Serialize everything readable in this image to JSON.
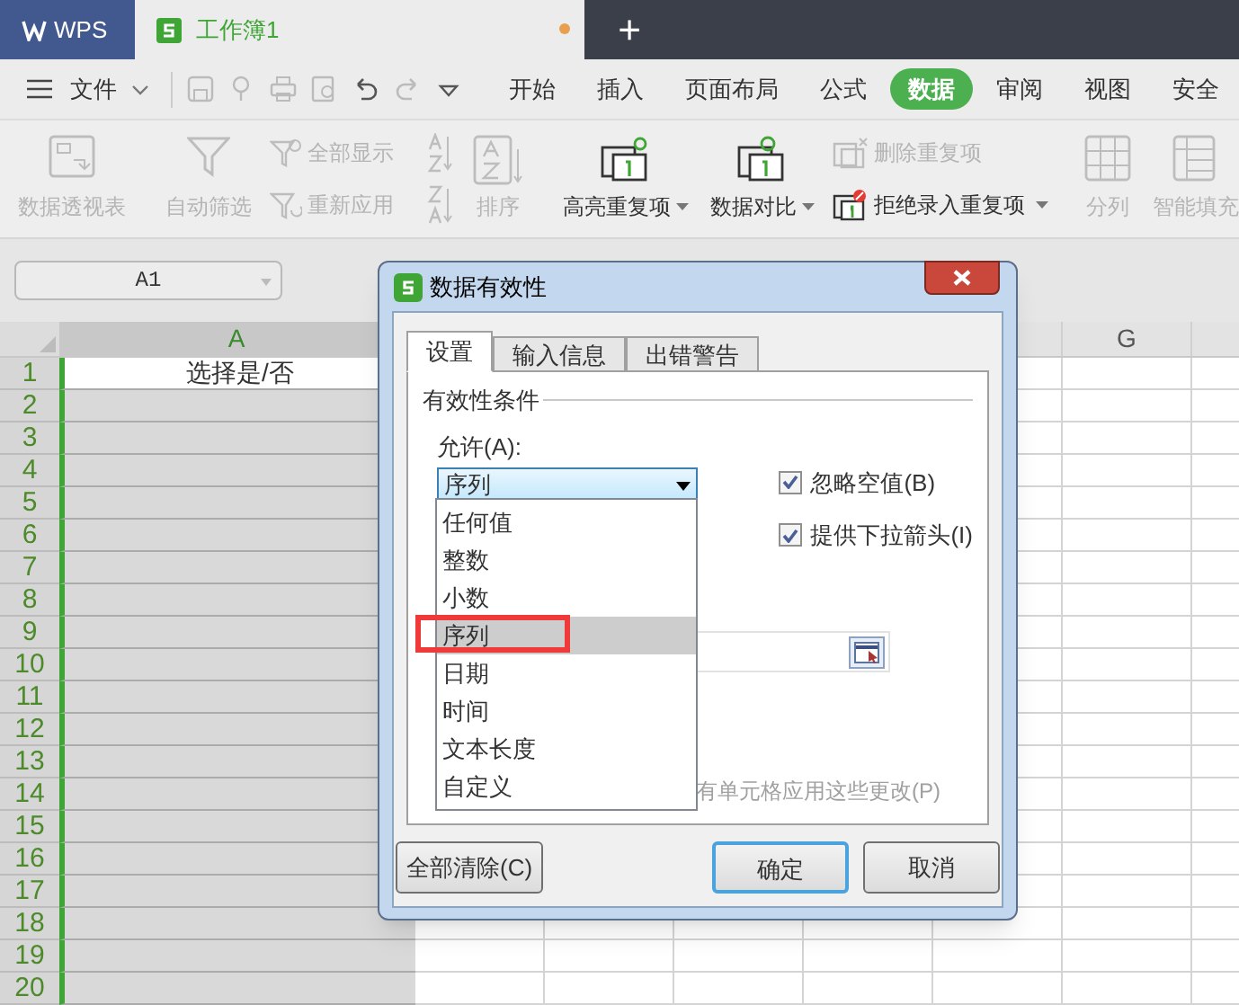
{
  "app_tabs": [
    {
      "kind": "home",
      "label": "WPS",
      "selected": false
    },
    {
      "kind": "doc",
      "label": "工作簿1",
      "selected": true,
      "unsaved": true
    }
  ],
  "new_tab": "+",
  "menu": {
    "file": "文件",
    "tabs": [
      {
        "label": "开始",
        "selected": false
      },
      {
        "label": "插入",
        "selected": false
      },
      {
        "label": "页面布局",
        "selected": false
      },
      {
        "label": "公式",
        "selected": false
      },
      {
        "label": "数据",
        "selected": true
      },
      {
        "label": "审阅",
        "selected": false
      },
      {
        "label": "视图",
        "selected": false
      },
      {
        "label": "安全",
        "selected": false
      }
    ]
  },
  "ribbon": [
    {
      "kind": "large",
      "label": "数据透视表",
      "disabled": true
    },
    {
      "kind": "divider"
    },
    {
      "kind": "large",
      "label": "自动筛选",
      "disabled": true
    },
    {
      "kind": "stack",
      "items": [
        {
          "label": "全部显示",
          "disabled": true
        },
        {
          "label": "重新应用",
          "disabled": true
        }
      ]
    },
    {
      "kind": "divider"
    },
    {
      "kind": "stack",
      "items": [
        {
          "disabled": true
        },
        {
          "disabled": true
        }
      ]
    },
    {
      "kind": "large",
      "label": "排序",
      "disabled": true
    },
    {
      "kind": "divider"
    },
    {
      "kind": "large",
      "label": "高亮重复项",
      "disabled": false,
      "menu": true
    },
    {
      "kind": "large",
      "label": "数据对比",
      "disabled": false,
      "menu": true
    },
    {
      "kind": "stack",
      "items": [
        {
          "label": "删除重复项",
          "disabled": true
        },
        {
          "label": "拒绝录入重复项",
          "disabled": false,
          "menu": true
        }
      ]
    },
    {
      "kind": "divider"
    },
    {
      "kind": "large",
      "label": "分列",
      "disabled": true
    },
    {
      "kind": "large",
      "label": "智能填充",
      "disabled": true
    }
  ],
  "name_box": "A1",
  "sheet": {
    "columns": [
      {
        "label": "A",
        "selected": true
      },
      {
        "label": "G",
        "selected": false
      }
    ],
    "rows": [
      {
        "number": "1",
        "cells": [
          "选择是/否"
        ]
      },
      {
        "number": "2"
      },
      {
        "number": "3"
      },
      {
        "number": "4"
      },
      {
        "number": "5"
      },
      {
        "number": "6"
      },
      {
        "number": "7"
      },
      {
        "number": "8"
      },
      {
        "number": "9"
      },
      {
        "number": "10"
      },
      {
        "number": "11"
      },
      {
        "number": "12"
      },
      {
        "number": "13"
      },
      {
        "number": "14"
      },
      {
        "number": "15"
      },
      {
        "number": "16"
      },
      {
        "number": "17"
      },
      {
        "number": "18"
      },
      {
        "number": "19"
      },
      {
        "number": "20"
      }
    ]
  },
  "dialog": {
    "title": "数据有效性",
    "tabs": [
      {
        "label": "设置",
        "selected": true
      },
      {
        "label": "输入信息",
        "selected": false
      },
      {
        "label": "出错警告",
        "selected": false
      }
    ],
    "group": "有效性条件",
    "allow_label": "允许(A):",
    "allow_value": "序列",
    "options": [
      {
        "label": "任何值",
        "selected": false
      },
      {
        "label": "整数",
        "selected": false
      },
      {
        "label": "小数",
        "selected": false
      },
      {
        "label": "序列",
        "selected": true,
        "annotated": true
      },
      {
        "label": "日期",
        "selected": false
      },
      {
        "label": "时间",
        "selected": false
      },
      {
        "label": "文本长度",
        "selected": false
      },
      {
        "label": "自定义",
        "selected": false
      }
    ],
    "checkboxes": [
      {
        "label": "忽略空值(B)",
        "checked": true
      },
      {
        "label": "提供下拉箭头(I)",
        "checked": true
      }
    ],
    "apply_all": {
      "label": "有单元格应用这些更改(P)",
      "disabled": true
    },
    "buttons": [
      {
        "label": "全部清除(C)",
        "default": false
      },
      {
        "label": "确定",
        "default": true
      },
      {
        "label": "取消",
        "default": false
      }
    ]
  }
}
